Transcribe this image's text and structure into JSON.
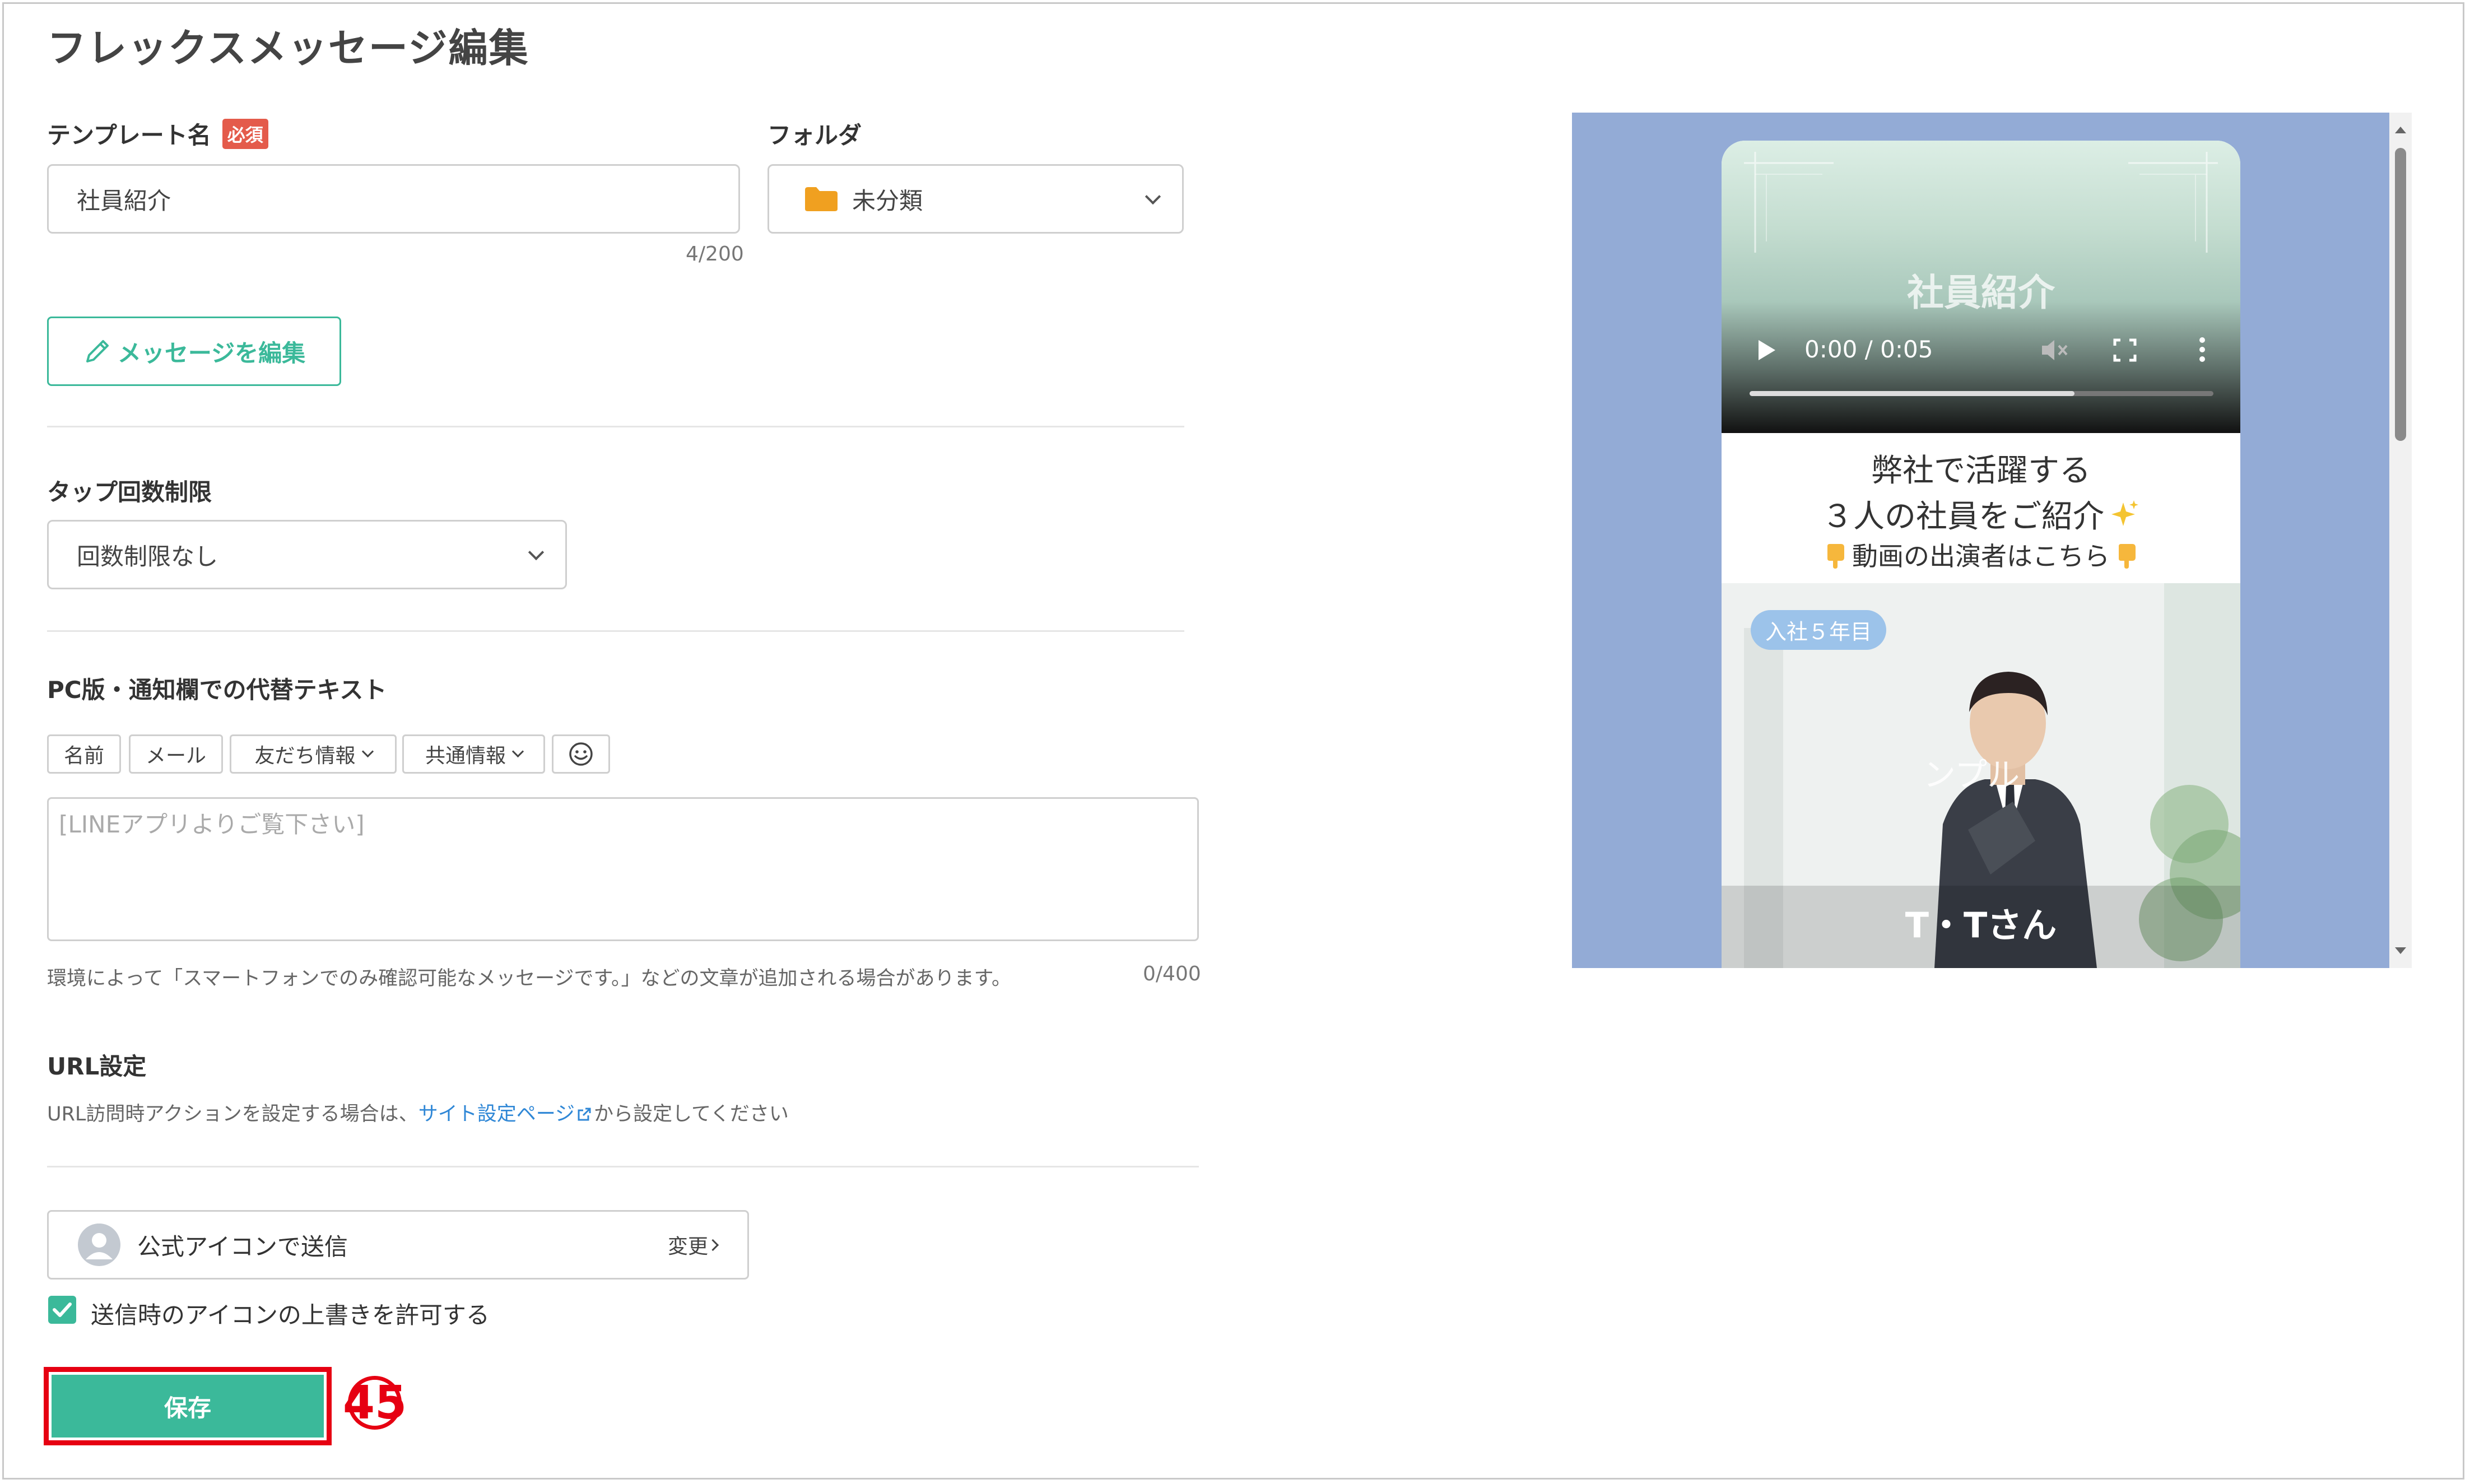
{
  "page_title": "フレックスメッセージ編集",
  "template": {
    "label": "テンプレート名",
    "required_badge": "必須",
    "value": "社員紹介",
    "counter": "4/200"
  },
  "folder": {
    "label": "フォルダ",
    "value": "未分類"
  },
  "edit_message_button": "メッセージを編集",
  "tap_limit": {
    "label": "タップ回数制限",
    "value": "回数制限なし"
  },
  "alt_text": {
    "label": "PC版・通知欄での代替テキスト",
    "chips": [
      "名前",
      "メール",
      "友だち情報",
      "共通情報"
    ],
    "placeholder": "[LINEアプリよりご覧下さい]",
    "note": "環境によって「スマートフォンでのみ確認可能なメッセージです。」などの文章が追加される場合があります。",
    "counter": "0/400"
  },
  "url_settings": {
    "label": "URL設定",
    "text_before": "URL訪問時アクションを設定する場合は、",
    "link": "サイト設定ページ",
    "text_after": "から設定してください"
  },
  "sender": {
    "label": "公式アイコンで送信",
    "change": "変更"
  },
  "override_checkbox": {
    "label": "送信時のアイコンの上書きを許可する",
    "checked": true
  },
  "save_button": "保存",
  "annotation_number": "45",
  "preview": {
    "video_title": "社員紹介",
    "time": "0:00 / 0:05",
    "progress": 0.7,
    "line1": "弊社で活躍する",
    "line2": "３人の社員をご紹介",
    "line3": "動画の出演者はこちら",
    "year_badge": "入社５年目",
    "overlay_text": "ンプル",
    "person_name": "T・Tさん"
  },
  "colors": {
    "accent": "#3bb99a",
    "required": "#e45b4b",
    "link": "#2f87d6",
    "preview_bg": "#93abd6",
    "highlight": "#e60012"
  }
}
